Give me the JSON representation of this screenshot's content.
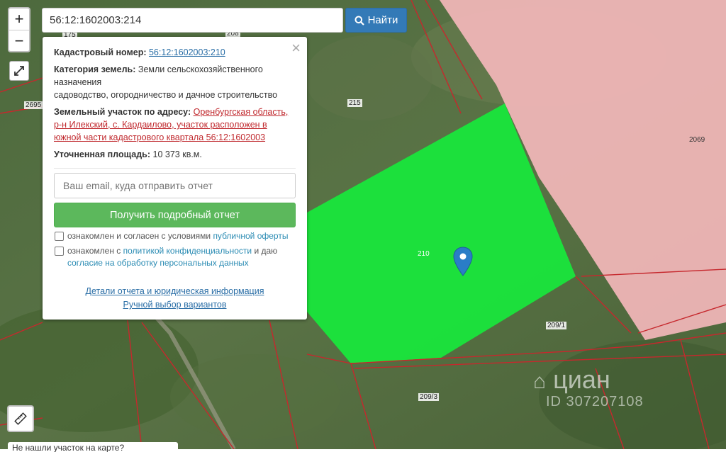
{
  "map": {
    "parcel_labels": {
      "p175": "175",
      "p208": "208",
      "p2695": "2695",
      "p215": "215",
      "p2069": "2069",
      "p210": "210",
      "p2091": "209/1",
      "p2093": "209/3"
    },
    "colors": {
      "selected_parcel": "#19e63c",
      "neighbor_parcel": "#f2b7b9",
      "boundary": "#c6282d",
      "marker": "#2a7dc7"
    }
  },
  "controls": {
    "zoom_in": "+",
    "zoom_out": "−",
    "fullscreen_icon": "fullscreen-icon",
    "ruler_icon": "ruler-icon"
  },
  "search": {
    "value": "56:12:1602003:214",
    "button_label": "Найти",
    "button_icon": "search-icon"
  },
  "popup": {
    "close": "×",
    "cadastral_label": "Кадастровый номер:",
    "cadastral_value": "56:12:1602003:210",
    "category_label": "Категория земель:",
    "category_value_1": "Земли сельскохозяйственного назначения",
    "category_value_2": "садоводство, огородничество и дачное строительство",
    "address_label": "Земельный участок по адресу:",
    "address_value": "Оренбургская область, р-н Илекский, с. Кардаилово, участок расположен в южной части кадастрового квартала 56:12:1602003",
    "area_label": "Уточненная площадь:",
    "area_value": "10 373 кв.м.",
    "email_placeholder": "Ваш email, куда отправить отчет",
    "report_button": "Получить подробный отчет",
    "consent1_text": "ознакомлен и согласен с условиями ",
    "consent1_link": "публичной оферты",
    "consent2_text1": "ознакомлен с ",
    "consent2_link1": "политикой конфиденциальности",
    "consent2_text2": " и даю",
    "consent2_link2": "согласие на обработку персональных данных",
    "details_link": "Детали отчета и юридическая информация",
    "manual_link": "Ручной выбор вариантов"
  },
  "watermark": {
    "brand": "циан",
    "id_text": "ID 307207108"
  },
  "bottom_bar": {
    "text": "Не нашли участок на карте?"
  }
}
